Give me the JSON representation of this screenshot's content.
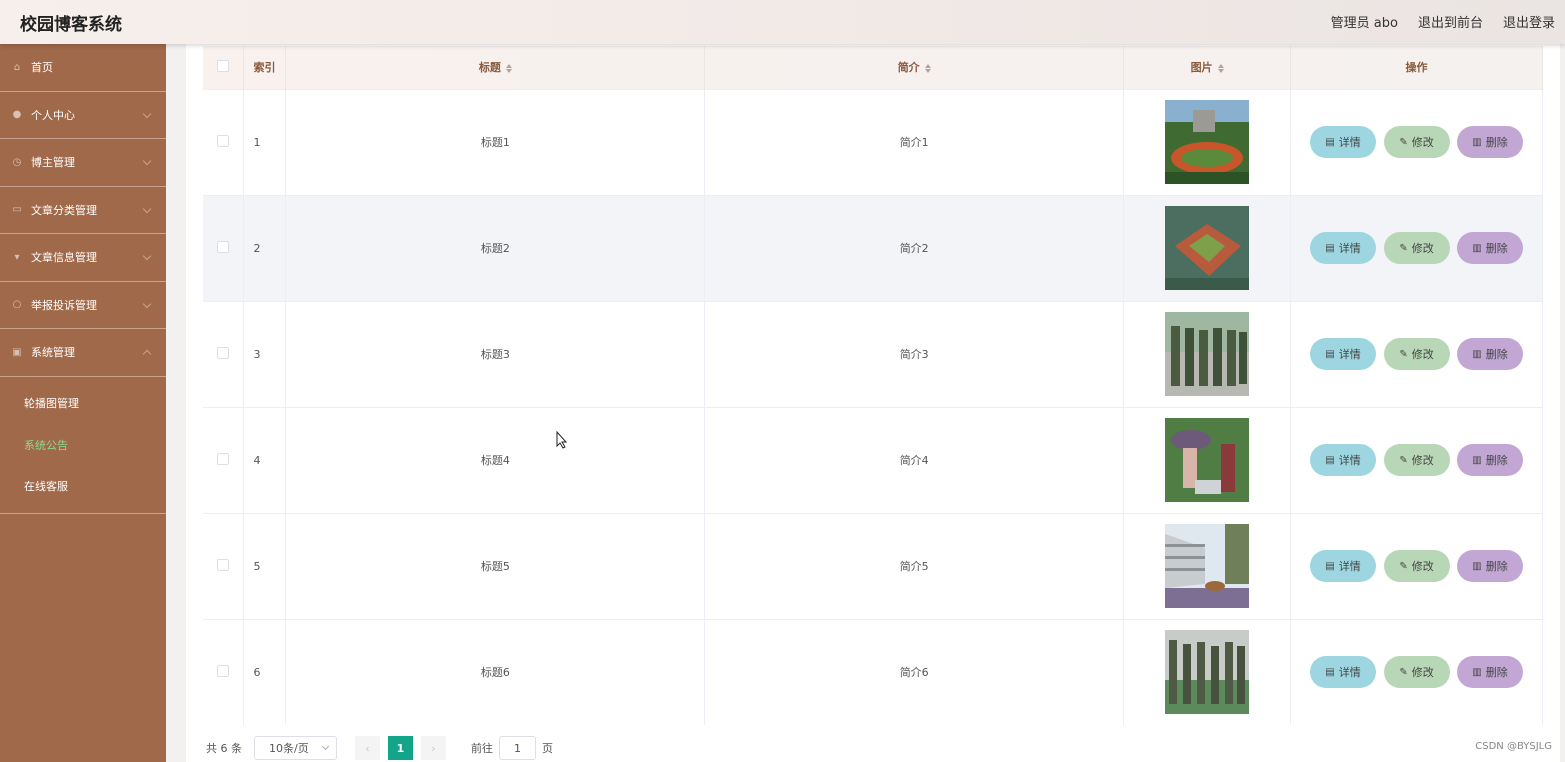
{
  "app": {
    "title": "校园博客系统"
  },
  "header": {
    "user": "管理员 abo",
    "to_front": "退出到前台",
    "logout": "退出登录"
  },
  "sidebar": {
    "items": [
      {
        "label": "首页",
        "icon": "home-icon"
      },
      {
        "label": "个人中心",
        "icon": "user-icon"
      },
      {
        "label": "博主管理",
        "icon": "clock-icon"
      },
      {
        "label": "文章分类管理",
        "icon": "keyboard-icon"
      },
      {
        "label": "文章信息管理",
        "icon": "monitor-icon"
      },
      {
        "label": "举报投诉管理",
        "icon": "power-icon"
      },
      {
        "label": "系统管理",
        "icon": "window-icon"
      }
    ],
    "subitems": [
      {
        "label": "轮播图管理"
      },
      {
        "label": "系统公告"
      },
      {
        "label": "在线客服"
      }
    ]
  },
  "table": {
    "headers": {
      "index": "索引",
      "title": "标题",
      "intro": "简介",
      "image": "图片",
      "actions": "操作"
    },
    "rows": [
      {
        "index": "1",
        "title": "标题1",
        "intro": "简介1"
      },
      {
        "index": "2",
        "title": "标题2",
        "intro": "简介2"
      },
      {
        "index": "3",
        "title": "标题3",
        "intro": "简介3"
      },
      {
        "index": "4",
        "title": "标题4",
        "intro": "简介4"
      },
      {
        "index": "5",
        "title": "标题5",
        "intro": "简介5"
      },
      {
        "index": "6",
        "title": "标题6",
        "intro": "简介6"
      }
    ],
    "actions": {
      "detail": "详情",
      "edit": "修改",
      "delete": "删除"
    }
  },
  "pager": {
    "total": "共 6 条",
    "page_size": "10条/页",
    "current_page": "1",
    "goto_label": "前往",
    "goto_value": "1",
    "page_unit": "页"
  },
  "watermark": "CSDN @BYSJLG",
  "colors": {
    "sidebar": "#a0694a",
    "active_sub": "#8fd98f",
    "page_active": "#12a58a"
  }
}
